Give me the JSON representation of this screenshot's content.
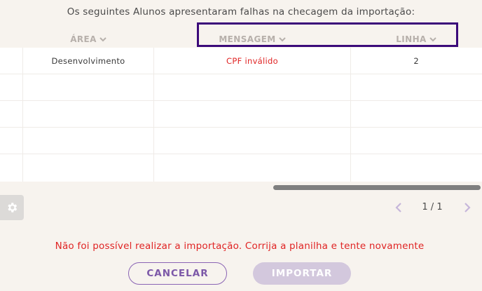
{
  "dialog": {
    "title": "Os seguintes Alunos apresentaram falhas na checagem da importação:",
    "error_message": "Não foi possível realizar a importação. Corrija a planilha e tente novamente"
  },
  "table": {
    "columns": [
      {
        "label": "ÁREA",
        "icon": "chevron-down-icon"
      },
      {
        "label": "MENSAGEM",
        "icon": "chevron-down-icon"
      },
      {
        "label": "LINHA",
        "icon": "chevron-down-icon"
      }
    ],
    "rows": [
      {
        "area": "Desenvolvimento",
        "mensagem": "CPF inválido",
        "linha": "2"
      }
    ],
    "empty_rows": 4
  },
  "pagination": {
    "label": "1 / 1",
    "prev_icon": "chevron-left-icon",
    "next_icon": "chevron-right-icon"
  },
  "settings": {
    "icon": "gear-icon"
  },
  "buttons": {
    "cancel": "CANCELAR",
    "import": "IMPORTAR"
  },
  "colors": {
    "error": "#e02424",
    "accent": "#7c58a8",
    "highlight_border": "#3b0a7a",
    "disabled_button": "#d3c8dd"
  }
}
